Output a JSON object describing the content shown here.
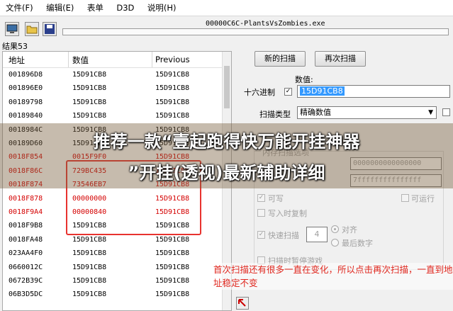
{
  "menu": [
    "文件(F)",
    "编辑(E)",
    "表单",
    "D3D",
    "说明(H)"
  ],
  "toolbar": {
    "icons": [
      "computer-icon",
      "open-folder-icon",
      "save-icon"
    ]
  },
  "process_title": "00000C6C-PlantsVsZombies.exe",
  "result_count": "结果53",
  "columns": [
    "地址",
    "数值",
    "Previous"
  ],
  "rows": [
    {
      "addr": "001896D8",
      "val": "15D91CB8",
      "prev": "15D91CB8",
      "red": false
    },
    {
      "addr": "001896E0",
      "val": "15D91CB8",
      "prev": "15D91CB8",
      "red": false
    },
    {
      "addr": "00189798",
      "val": "15D91CB8",
      "prev": "15D91CB8",
      "red": false
    },
    {
      "addr": "00189840",
      "val": "15D91CB8",
      "prev": "15D91CB8",
      "red": false
    },
    {
      "addr": "0018984C",
      "val": "15D91CB8",
      "prev": "15D91CB8",
      "red": false
    },
    {
      "addr": "00189D60",
      "val": "15D91CB8",
      "prev": "15D91CB8",
      "red": false
    },
    {
      "addr": "0018F854",
      "val": "0015F9F0",
      "prev": "15D91CB8",
      "red": true
    },
    {
      "addr": "0018F86C",
      "val": "729BC435",
      "prev": "15D91CB8",
      "red": true
    },
    {
      "addr": "0018F874",
      "val": "73546EB7",
      "prev": "15D91CB8",
      "red": true
    },
    {
      "addr": "0018F878",
      "val": "00000000",
      "prev": "15D91CB8",
      "red": true
    },
    {
      "addr": "0018F9A4",
      "val": "00000840",
      "prev": "15D91CB8",
      "red": true
    },
    {
      "addr": "0018F9B8",
      "val": "15D91CB8",
      "prev": "15D91CB8",
      "red": false
    },
    {
      "addr": "0018FA48",
      "val": "15D91CB8",
      "prev": "15D91CB8",
      "red": false
    },
    {
      "addr": "023AA4F0",
      "val": "15D91CB8",
      "prev": "15D91CB8",
      "red": false
    },
    {
      "addr": "0660012C",
      "val": "15D91CB8",
      "prev": "15D91CB8",
      "red": false
    },
    {
      "addr": "0672B39C",
      "val": "15D91CB8",
      "prev": "15D91CB8",
      "red": false
    },
    {
      "addr": "06B3D5DC",
      "val": "15D91CB8",
      "prev": "15D91CB8",
      "red": false
    }
  ],
  "buttons": {
    "new_scan": "新的扫描",
    "next_scan": "再次扫描"
  },
  "value_label": "数值:",
  "hex_label": "十六进制",
  "hex_checked": true,
  "value_input": "15D91CB8",
  "scan_type_label": "扫描类型",
  "scan_type_value": "精确数值",
  "memory_options_label": "内存扫描选项",
  "range_start": "0000000000000000",
  "range_end": "7fffffffffffffff",
  "writable_label": "可写",
  "executable_label": "可运行",
  "copy_on_write_label": "写入时复制",
  "fast_scan_label": "快速扫描",
  "fast_scan_value": "4",
  "align_label": "对齐",
  "last_digits_label": "最后数字",
  "pause_label": "扫描时暂停游戏",
  "banner_line1": "推荐一款“壹起跑得快万能开挂神器",
  "banner_line2": "”开挂(透视)最新辅助详细",
  "note": "首次扫描还有很多一直在变化，所以点击再次扫描，一直到地址稳定不变",
  "colors": {
    "highlight": "#e8332f",
    "note_text": "#e0281f",
    "selection": "#3399ff"
  }
}
